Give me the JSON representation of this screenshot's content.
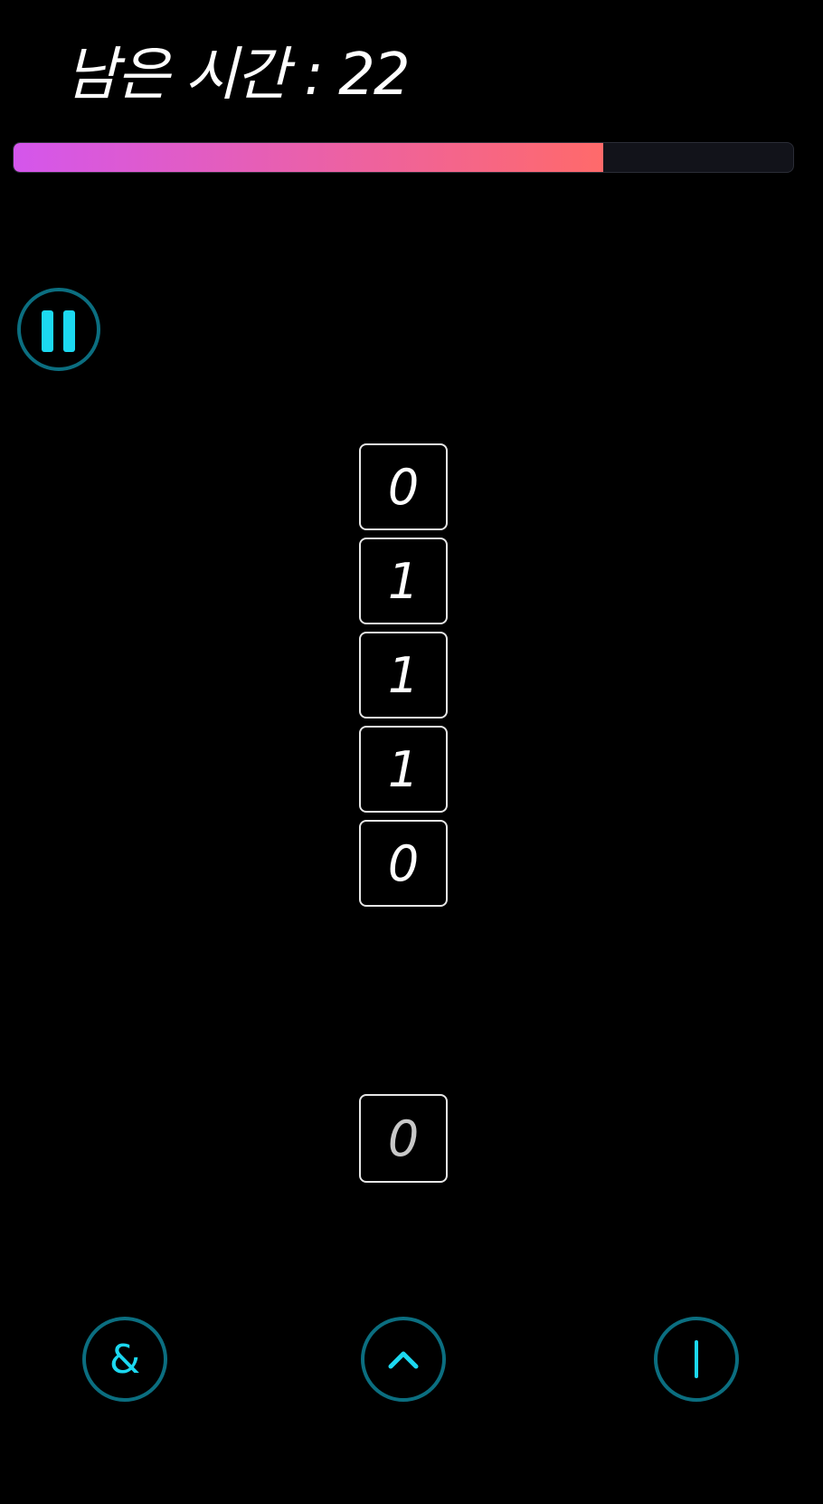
{
  "hud": {
    "timer_text": "남은 시간 : 22",
    "progress": 0.756,
    "progress_colors": [
      "#d456ec",
      "#ff6a6a"
    ]
  },
  "controls": {
    "pause_icon": "pause-icon",
    "and_label": "&",
    "xor_icon": "caret-up-icon",
    "or_icon": "vertical-bar-icon"
  },
  "stack": {
    "tiles": [
      "0",
      "1",
      "1",
      "1",
      "0"
    ]
  },
  "current": {
    "value": "0"
  },
  "colors": {
    "accent": "#1cd8f0",
    "ring": "#0b6e80",
    "tile_border": "#e6e6e6",
    "background": "#000000"
  }
}
